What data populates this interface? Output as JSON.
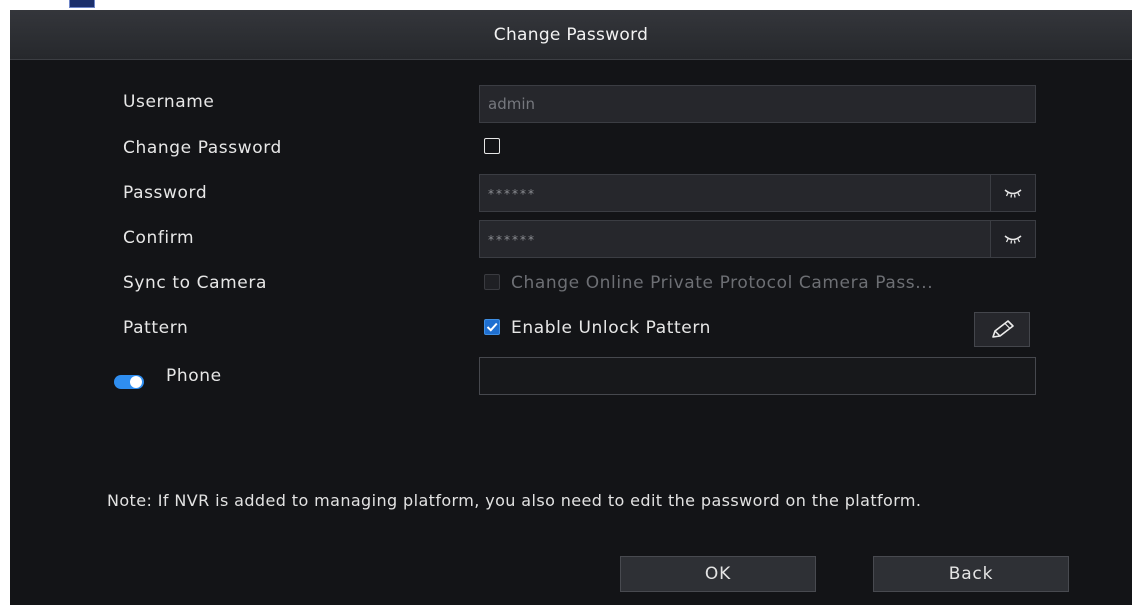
{
  "dialog": {
    "title": "Change Password"
  },
  "form": {
    "username": {
      "label": "Username",
      "value": "admin"
    },
    "change_password": {
      "label": "Change Password",
      "checked": false
    },
    "password": {
      "label": "Password",
      "value": "******"
    },
    "confirm": {
      "label": "Confirm",
      "value": "******"
    },
    "sync_to_camera": {
      "label": "Sync to Camera",
      "option_label": "Change Online Private Protocol Camera Pass...",
      "checked": false,
      "enabled": false
    },
    "pattern": {
      "label": "Pattern",
      "option_label": "Enable Unlock Pattern",
      "checked": true
    },
    "phone": {
      "label": "Phone",
      "toggle_on": true,
      "value": ""
    }
  },
  "note": "Note: If NVR is added to managing platform, you also need to edit the password on the platform.",
  "buttons": {
    "ok": "OK",
    "back": "Back"
  },
  "colors": {
    "accent": "#2f8ef0",
    "background": "#131417",
    "titlebar": "#2c2e32"
  }
}
